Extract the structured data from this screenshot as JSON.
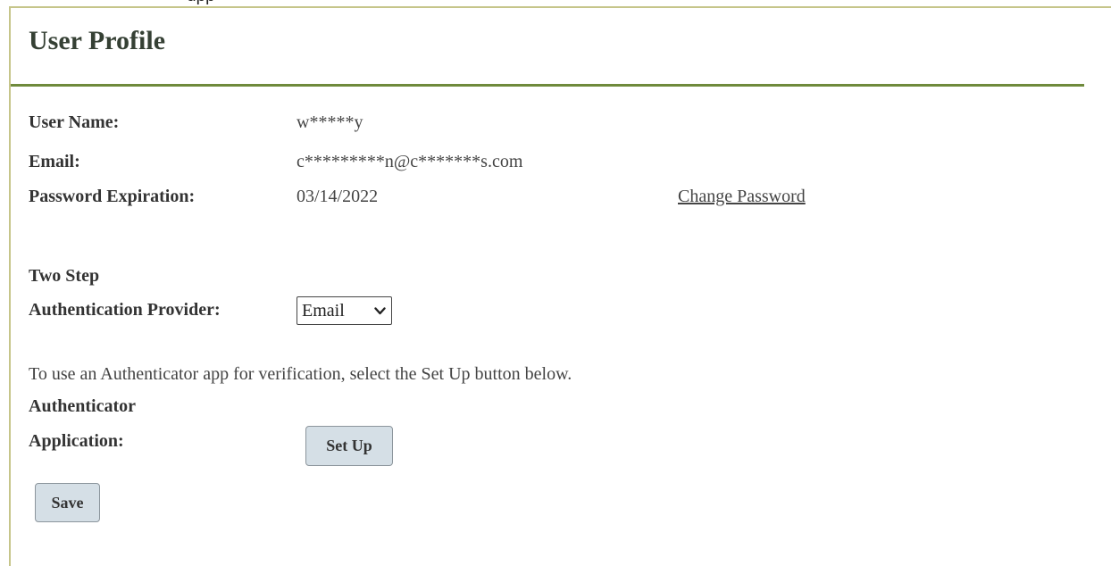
{
  "top_fragment": "upp",
  "page_title": "User Profile",
  "profile": {
    "user_name_label": "User Name:",
    "user_name_value": "w*****y",
    "email_label": "Email:",
    "email_value": "c*********n@c*******s.com",
    "password_expiration_label": "Password Expiration:",
    "password_expiration_value": "03/14/2022",
    "change_password_link": "Change Password"
  },
  "two_step": {
    "heading": "Two Step",
    "provider_label": "Authentication Provider:",
    "provider_selected": "Email"
  },
  "authenticator": {
    "info_text": "To use an Authenticator app for verification, select the Set Up button below.",
    "label_line1": "Authenticator",
    "label_line2": "Application:",
    "setup_button": "Set Up"
  },
  "save_button": "Save",
  "colors": {
    "title": "#354034",
    "rule": "#6f8a3c",
    "border": "#c6c58a",
    "button_bg": "#d5dfe6"
  },
  "icons": {
    "dropdown": "chevron-down-icon"
  }
}
